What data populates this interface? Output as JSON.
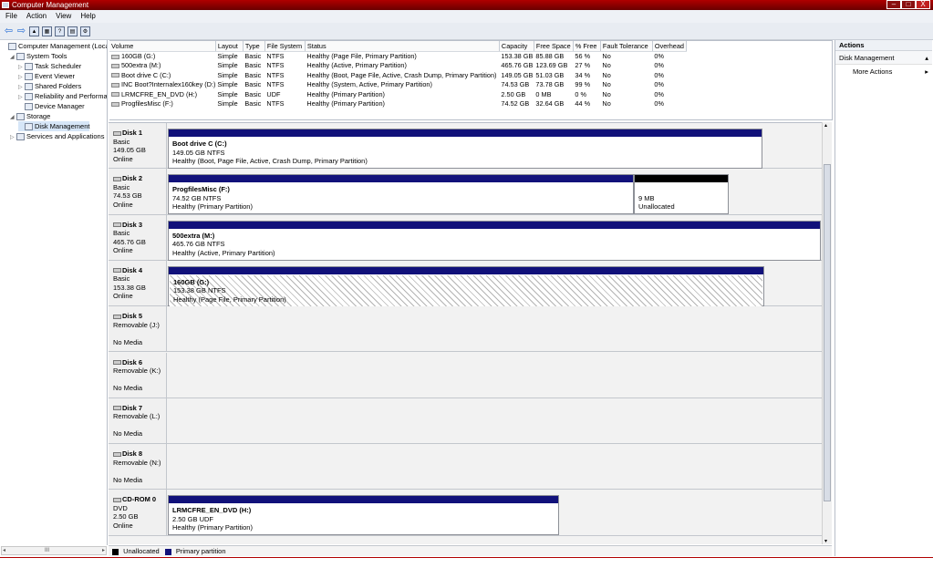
{
  "window": {
    "title": "Computer Management",
    "min": "–",
    "max": "□",
    "close": "X"
  },
  "menu": [
    "File",
    "Action",
    "View",
    "Help"
  ],
  "tree": [
    {
      "label": "Computer Management (Local",
      "indent": 0,
      "expander": ""
    },
    {
      "label": "System Tools",
      "indent": 1,
      "expander": "◢"
    },
    {
      "label": "Task Scheduler",
      "indent": 2,
      "expander": "▷"
    },
    {
      "label": "Event Viewer",
      "indent": 2,
      "expander": "▷"
    },
    {
      "label": "Shared Folders",
      "indent": 2,
      "expander": "▷"
    },
    {
      "label": "Reliability and Performa",
      "indent": 2,
      "expander": "▷"
    },
    {
      "label": "Device Manager",
      "indent": 2,
      "expander": ""
    },
    {
      "label": "Storage",
      "indent": 1,
      "expander": "◢"
    },
    {
      "label": "Disk Management",
      "indent": 2,
      "expander": "",
      "selected": true
    },
    {
      "label": "Services and Applications",
      "indent": 1,
      "expander": "▷"
    }
  ],
  "hscroll_thumb": "III",
  "volumes": {
    "headers": [
      "Volume",
      "Layout",
      "Type",
      "File System",
      "Status",
      "Capacity",
      "Free Space",
      "% Free",
      "Fault Tolerance",
      "Overhead"
    ],
    "rows": [
      [
        "160GB (G:)",
        "Simple",
        "Basic",
        "NTFS",
        "Healthy (Page File, Primary Partition)",
        "153.38 GB",
        "85.88 GB",
        "56 %",
        "No",
        "0%"
      ],
      [
        "500extra (M:)",
        "Simple",
        "Basic",
        "NTFS",
        "Healthy (Active, Primary Partition)",
        "465.76 GB",
        "123.69 GB",
        "27 %",
        "No",
        "0%"
      ],
      [
        "Boot drive C (C:)",
        "Simple",
        "Basic",
        "NTFS",
        "Healthy (Boot, Page File, Active, Crash Dump, Primary Partition)",
        "149.05 GB",
        "51.03 GB",
        "34 %",
        "No",
        "0%"
      ],
      [
        "INC Boot?Internalex160key (D:)",
        "Simple",
        "Basic",
        "NTFS",
        "Healthy (System, Active, Primary Partition)",
        "74.53 GB",
        "73.78 GB",
        "99 %",
        "No",
        "0%"
      ],
      [
        "LRMCFRE_EN_DVD (H:)",
        "Simple",
        "Basic",
        "UDF",
        "Healthy (Primary Partition)",
        "2.50 GB",
        "0 MB",
        "0 %",
        "No",
        "0%"
      ],
      [
        "ProgfilesMisc (F:)",
        "Simple",
        "Basic",
        "NTFS",
        "Healthy (Primary Partition)",
        "74.52 GB",
        "32.64 GB",
        "44 %",
        "No",
        "0%"
      ]
    ]
  },
  "disks": [
    {
      "name": "Disk 1",
      "l1": "Basic",
      "l2": "149.05 GB",
      "l3": "Online",
      "parts": [
        {
          "name": "Boot drive C  (C:)",
          "size": "149.05 GB NTFS",
          "status": "Healthy (Boot, Page File, Active, Crash Dump, Primary Partition)"
        }
      ]
    },
    {
      "name": "Disk 2",
      "l1": "Basic",
      "l2": "74.53 GB",
      "l3": "Online",
      "parts": [
        {
          "name": "ProgfilesMisc  (F:)",
          "size": "74.52 GB NTFS",
          "status": "Healthy (Primary Partition)"
        },
        {
          "name": "",
          "size": "9 MB",
          "status": "Unallocated"
        }
      ]
    },
    {
      "name": "Disk 3",
      "l1": "Basic",
      "l2": "465.76 GB",
      "l3": "Online",
      "parts": [
        {
          "name": "500extra  (M:)",
          "size": "465.76 GB NTFS",
          "status": "Healthy (Active, Primary Partition)"
        }
      ]
    },
    {
      "name": "Disk 4",
      "l1": "Basic",
      "l2": "153.38 GB",
      "l3": "Online",
      "parts": [
        {
          "name": "160GB  (G:)",
          "size": "153.38 GB NTFS",
          "status": "Healthy (Page File, Primary Partition)"
        }
      ]
    },
    {
      "name": "Disk 5",
      "l1": "Removable (J:)",
      "l2": "",
      "l3": "No Media",
      "parts": []
    },
    {
      "name": "Disk 6",
      "l1": "Removable (K:)",
      "l2": "",
      "l3": "No Media",
      "parts": []
    },
    {
      "name": "Disk 7",
      "l1": "Removable (L:)",
      "l2": "",
      "l3": "No Media",
      "parts": []
    },
    {
      "name": "Disk 8",
      "l1": "Removable (N:)",
      "l2": "",
      "l3": "No Media",
      "parts": []
    },
    {
      "name": "CD-ROM 0",
      "l1": "DVD",
      "l2": "2.50 GB",
      "l3": "Online",
      "parts": [
        {
          "name": "LRMCFRE_EN_DVD  (H:)",
          "size": "2.50 GB UDF",
          "status": "Healthy (Primary Partition)"
        }
      ]
    }
  ],
  "legend": {
    "unallocated": "Unallocated",
    "primary": "Primary partition"
  },
  "actions": {
    "header": "Actions",
    "section": "Disk Management",
    "more": "More Actions",
    "section_arrow": "▴",
    "more_arrow": "▸"
  },
  "colors": {
    "primary_partition": "#11117a",
    "unallocated": "#000000",
    "title_bar": "#9b0000"
  }
}
